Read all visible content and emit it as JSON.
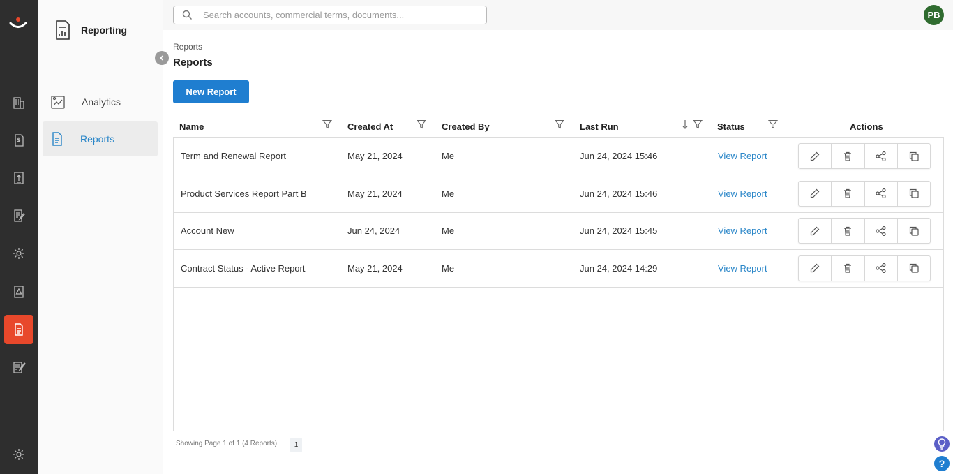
{
  "subnav": {
    "title": "Reporting",
    "items": [
      {
        "label": "Analytics",
        "icon": "analytics-icon"
      },
      {
        "label": "Reports",
        "icon": "report-document-icon"
      }
    ]
  },
  "search": {
    "placeholder": "Search accounts, commercial terms, documents..."
  },
  "user": {
    "initials": "PB",
    "avatar_color": "#2f6b2f"
  },
  "breadcrumb": "Reports",
  "page_title": "Reports",
  "new_report_label": "New Report",
  "columns": [
    "Name",
    "Created At",
    "Created By",
    "Last Run",
    "Status",
    "Actions"
  ],
  "rows": [
    {
      "name": "Term and Renewal Report",
      "created_at": "May 21, 2024",
      "created_by": "Me",
      "last_run": "Jun 24, 2024 15:46",
      "status": "View Report"
    },
    {
      "name": "Product Services Report Part B",
      "created_at": "May 21, 2024",
      "created_by": "Me",
      "last_run": "Jun 24, 2024 15:46",
      "status": "View Report"
    },
    {
      "name": "Account New",
      "created_at": "Jun 24, 2024",
      "created_by": "Me",
      "last_run": "Jun 24, 2024 15:45",
      "status": "View Report"
    },
    {
      "name": "Contract Status - Active Report",
      "created_at": "May 21, 2024",
      "created_by": "Me",
      "last_run": "Jun 24, 2024 14:29",
      "status": "View Report"
    }
  ],
  "footer": {
    "showing": "Showing Page 1 of 1 (4 Reports)",
    "page": "1"
  },
  "colors": {
    "accent": "#1f7ed0",
    "rail_active": "#e8482b",
    "link": "#2a86c8",
    "rail_bg": "#2e2e2e"
  }
}
